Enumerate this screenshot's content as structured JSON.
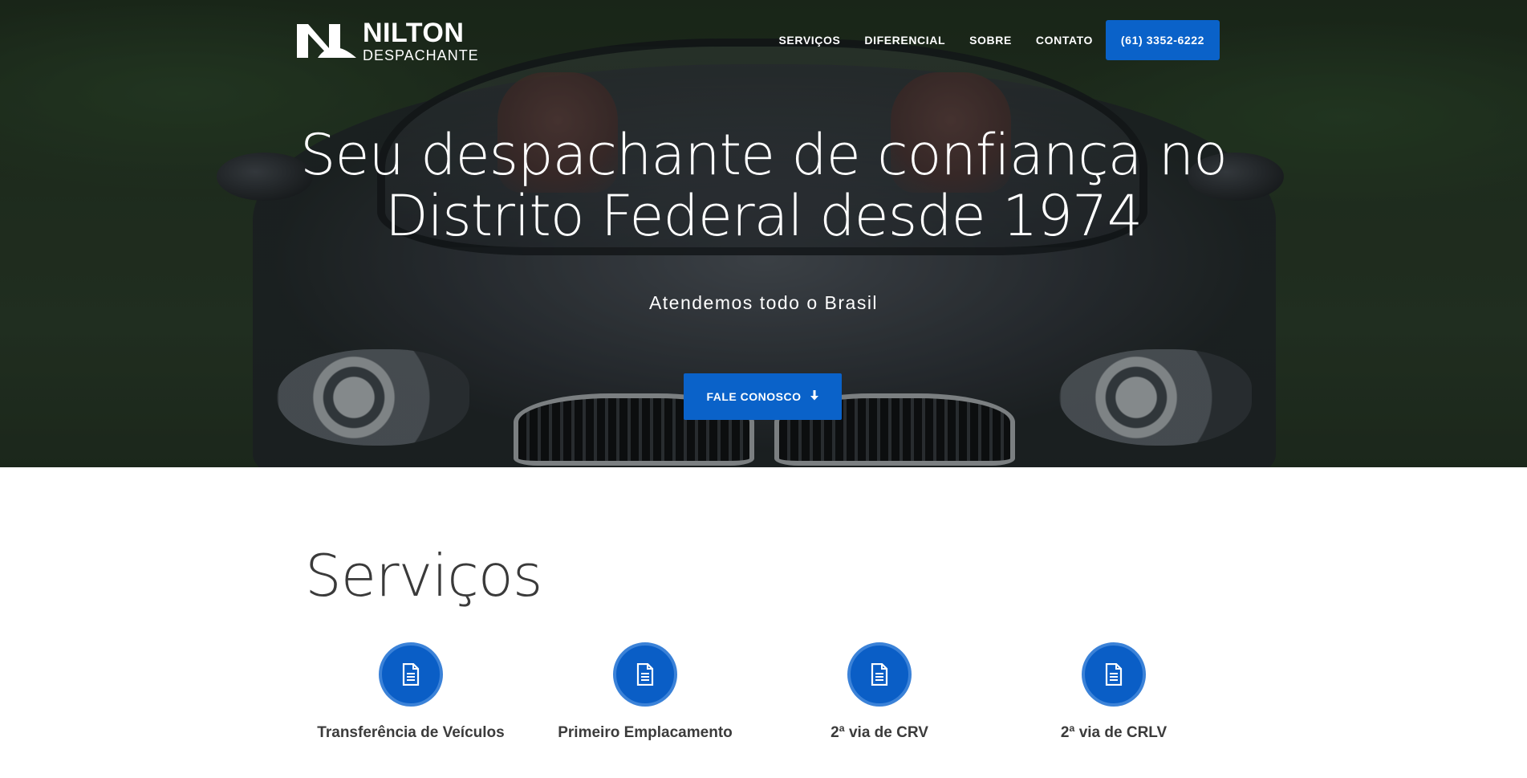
{
  "header": {
    "logo": {
      "name": "NILTON",
      "sub": "DESPACHANTE"
    },
    "nav": [
      {
        "label": "SERVIÇOS"
      },
      {
        "label": "DIFERENCIAL"
      },
      {
        "label": "SOBRE"
      },
      {
        "label": "CONTATO"
      }
    ],
    "phone_button": "(61) 3352-6222"
  },
  "hero": {
    "title_line1": "Seu despachante de confiança no",
    "title_line2": "Distrito Federal desde 1974",
    "subtitle": "Atendemos todo o Brasil",
    "cta_label": "FALE CONOSCO"
  },
  "services": {
    "title": "Serviços",
    "items": [
      {
        "label": "Transferência de Veículos",
        "icon": "document-icon"
      },
      {
        "label": "Primeiro Emplacamento",
        "icon": "document-icon"
      },
      {
        "label": "2ª via de CRV",
        "icon": "document-icon"
      },
      {
        "label": "2ª via de CRLV",
        "icon": "document-icon"
      }
    ]
  },
  "colors": {
    "accent": "#0a62c9",
    "text": "#3b3b3b"
  }
}
